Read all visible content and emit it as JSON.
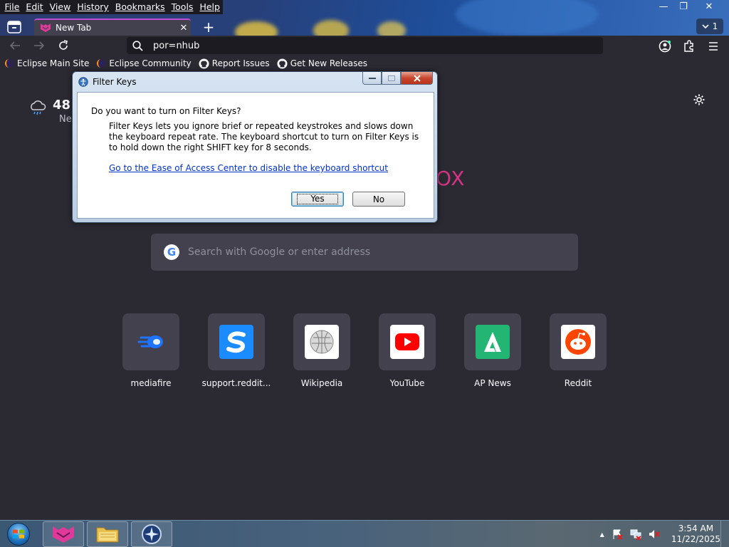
{
  "menu": [
    "File",
    "Edit",
    "View",
    "History",
    "Bookmarks",
    "Tools",
    "Help"
  ],
  "window_controls": {
    "minimize": "—",
    "maximize": "❐",
    "close": "✕"
  },
  "tab": {
    "title": "New Tab",
    "close": "✕",
    "new_tab": "+"
  },
  "tab_count": "1",
  "url": "por=nhub",
  "bookmarks": [
    {
      "label": "Eclipse Main Site",
      "icon": "eclipse-icon"
    },
    {
      "label": "Eclipse Community",
      "icon": "eclipse-icon"
    },
    {
      "label": "Report Issues",
      "icon": "github-icon"
    },
    {
      "label": "Get New Releases",
      "icon": "github-icon"
    }
  ],
  "weather": {
    "temp": "48",
    "condition": "Ne"
  },
  "logo_fragment": "OX",
  "search": {
    "placeholder": "Search with Google or enter address",
    "engine_letter": "G"
  },
  "shortcuts": [
    {
      "label": "mediafire",
      "icon": "mediafire-icon",
      "color": "#2b2a33"
    },
    {
      "label": "support.reddit...",
      "icon": "reddit-support-icon",
      "color": "#1a8cff"
    },
    {
      "label": "Wikipedia",
      "icon": "wikipedia-icon",
      "color": "#ffffff"
    },
    {
      "label": "YouTube",
      "icon": "youtube-icon",
      "color": "#ffffff"
    },
    {
      "label": "AP News",
      "icon": "apnews-icon",
      "color": "#22b573"
    },
    {
      "label": "Reddit",
      "icon": "reddit-icon",
      "color": "#ffffff"
    }
  ],
  "dialog": {
    "title": "Filter Keys",
    "question": "Do you want to turn on Filter Keys?",
    "description": "Filter Keys lets you ignore brief or repeated keystrokes and slows down the keyboard repeat rate.  The keyboard shortcut to turn on Filter Keys is to hold down the right SHIFT key for 8 seconds.",
    "link": "Go to the Ease of Access Center to disable the keyboard shortcut",
    "yes": "Yes",
    "no": "No"
  },
  "taskbar": {
    "time": "3:54 AM",
    "date": "11/22/2025",
    "tray_arrow": "▲"
  },
  "colors": {
    "accent": "#c04cd6",
    "toolbar": "#2b2a33",
    "content_bg": "#2b2a33",
    "link": "#0033cc"
  }
}
